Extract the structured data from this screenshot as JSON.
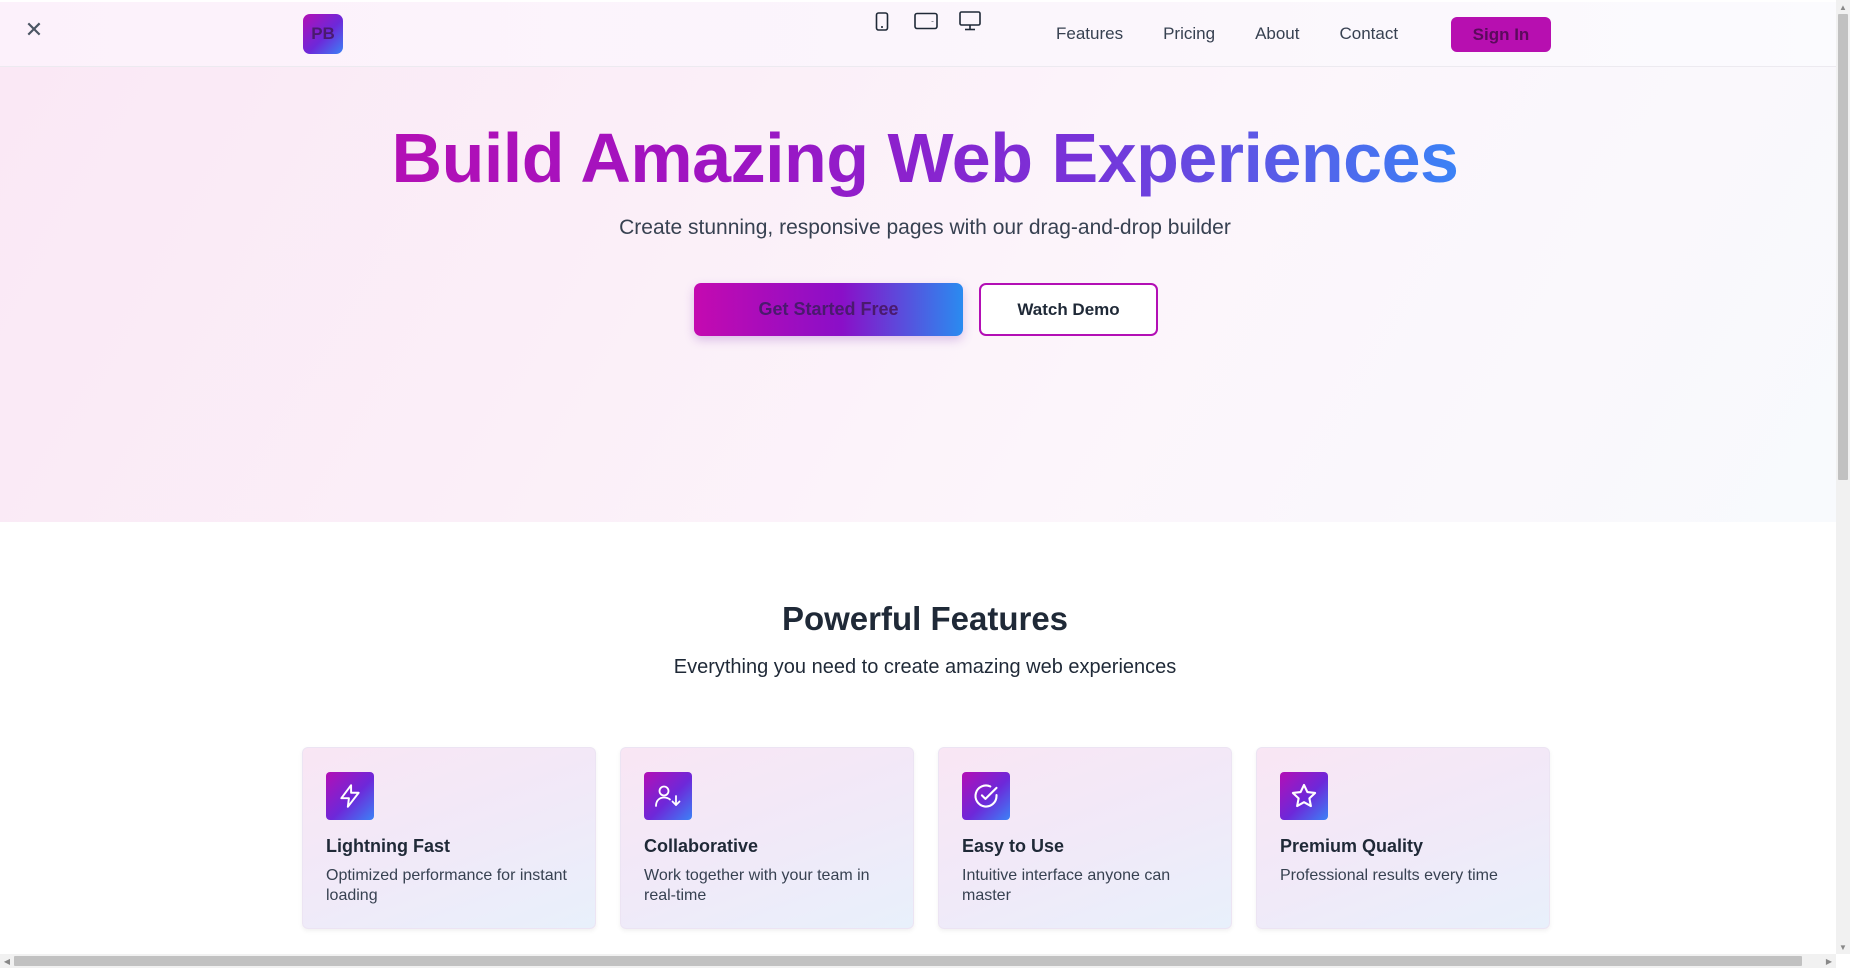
{
  "toolbar": {
    "close_label": "✕"
  },
  "logo": {
    "text": "PB"
  },
  "device_icons": [
    "phone-icon",
    "tablet-icon",
    "desktop-icon"
  ],
  "nav": {
    "links": [
      "Features",
      "Pricing",
      "About",
      "Contact"
    ],
    "signin_label": "Sign In"
  },
  "hero": {
    "title": "Build Amazing Web Experiences",
    "subtitle": "Create stunning, responsive pages with our drag-and-drop builder",
    "primary_cta": "Get Started Free",
    "secondary_cta": "Watch Demo"
  },
  "features": {
    "title": "Powerful Features",
    "subtitle": "Everything you need to create amazing web experiences",
    "cards": [
      {
        "icon": "lightning-icon",
        "title": "Lightning Fast",
        "desc": "Optimized performance for instant loading"
      },
      {
        "icon": "user-collab-icon",
        "title": "Collaborative",
        "desc": "Work together with your team in real-time"
      },
      {
        "icon": "check-circle-icon",
        "title": "Easy to Use",
        "desc": "Intuitive interface anyone can master"
      },
      {
        "icon": "star-icon",
        "title": "Premium Quality",
        "desc": "Professional results every time"
      }
    ]
  },
  "colors": {
    "brand_magenta": "#b30fb5",
    "brand_purple": "#6d28d9",
    "brand_blue": "#3b82f6"
  }
}
